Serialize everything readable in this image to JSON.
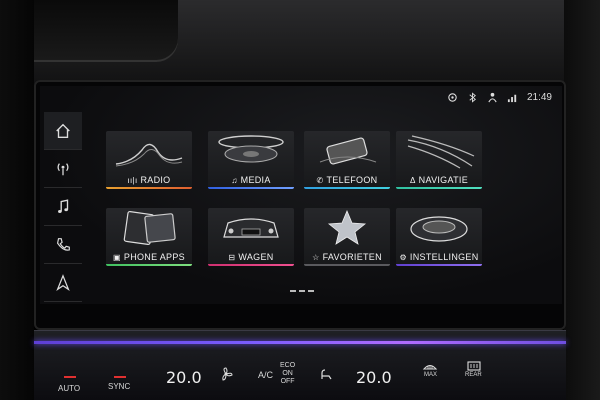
{
  "status_bar": {
    "icons": [
      "connected-car-icon",
      "bluetooth-icon",
      "driver-icon",
      "signal-icon"
    ],
    "time": "21:49"
  },
  "dock": {
    "items": [
      "home-icon",
      "radio-antenna-icon",
      "music-note-icon",
      "phone-icon",
      "navigation-arrow-icon"
    ]
  },
  "tiles": [
    {
      "label": "RADIO",
      "glyph": "ıı|ı",
      "accent": "#e8a030"
    },
    {
      "label": "MEDIA",
      "glyph": "♫",
      "accent": "#5a8cff"
    },
    {
      "label": "TELEFOON",
      "glyph": "✆",
      "accent": "#35c4e0"
    },
    {
      "label": "NAVIGATIE",
      "glyph": "Δ",
      "accent": "#40d0b0"
    },
    {
      "label": "PHONE APPS",
      "glyph": "▣",
      "accent": "#50e070"
    },
    {
      "label": "WAGEN",
      "glyph": "⊟",
      "accent": "#e04080"
    },
    {
      "label": "FAVORIETEN",
      "glyph": "☆",
      "accent": "#d0d0d0"
    },
    {
      "label": "INSTELLINGEN",
      "glyph": "⚙",
      "accent": "#8050e0"
    }
  ],
  "climate": {
    "auto": "AUTO",
    "sync": "SYNC",
    "temp_left": "20.0",
    "ac": "A/C",
    "eco": "ECO",
    "on": "ON",
    "off": "OFF",
    "temp_right": "20.0",
    "max": "MAX",
    "rear": "REAR"
  }
}
